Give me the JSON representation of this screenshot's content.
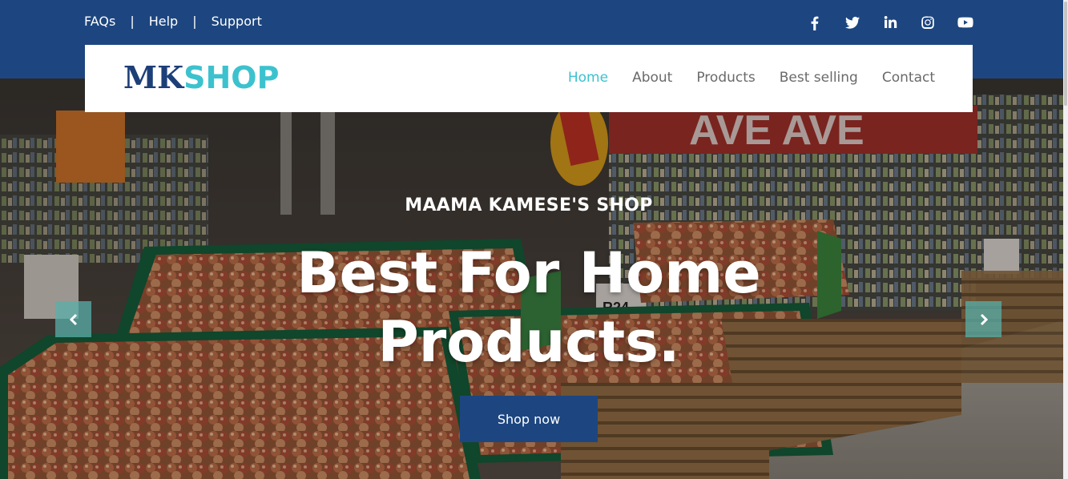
{
  "topbar": {
    "links": [
      "FAQs",
      "Help",
      "Support"
    ],
    "separator": "|",
    "social_icons": [
      "facebook-icon",
      "twitter-icon",
      "linkedin-icon",
      "instagram-icon",
      "youtube-icon"
    ]
  },
  "navbar": {
    "logo_part1": "MK",
    "logo_part2": "SHOP",
    "menu": [
      {
        "label": "Home",
        "active": true
      },
      {
        "label": "About",
        "active": false
      },
      {
        "label": "Products",
        "active": false
      },
      {
        "label": "Best selling",
        "active": false
      },
      {
        "label": "Contact",
        "active": false
      }
    ]
  },
  "hero": {
    "subtitle": "MAAMA KAMESE'S SHOP",
    "title_line1": "Best For Home",
    "title_line2": "Products.",
    "button_label": "Shop now",
    "prev_icon": "chevron-left-icon",
    "next_icon": "chevron-right-icon"
  },
  "colors": {
    "primary": "#1d4680",
    "accent": "#3cc2ce",
    "logo_dark": "#1d3f78"
  }
}
